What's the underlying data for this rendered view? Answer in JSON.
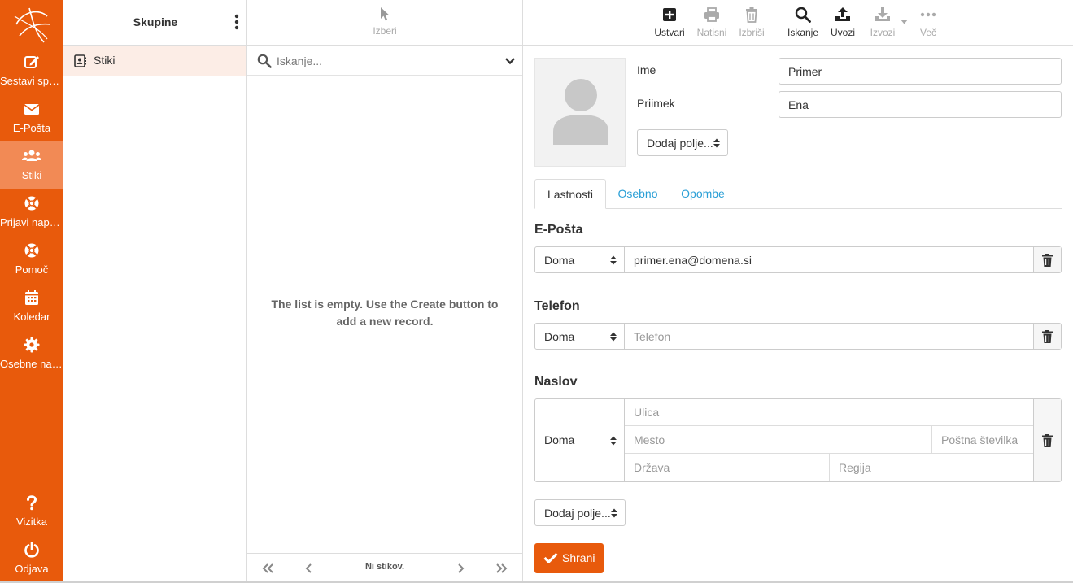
{
  "nav": {
    "items": [
      {
        "label": "Sestavi sporočilo",
        "icon": "compose-icon"
      },
      {
        "label": "E-Pošta",
        "icon": "envelope-icon"
      },
      {
        "label": "Stiki",
        "icon": "users-icon"
      },
      {
        "label": "Prijavi napako",
        "icon": "lifebuoy-icon"
      },
      {
        "label": "Pomoč",
        "icon": "lifebuoy-icon"
      },
      {
        "label": "Koledar",
        "icon": "calendar-icon"
      },
      {
        "label": "Osebne nastavitve",
        "icon": "gear-icon"
      },
      {
        "label": "Vizitka",
        "icon": "question-icon"
      },
      {
        "label": "Odjava",
        "icon": "power-icon"
      }
    ],
    "active_index": 2
  },
  "groups": {
    "title": "Skupine",
    "items": [
      {
        "label": "Stiki",
        "icon": "address-book-icon"
      }
    ]
  },
  "list": {
    "select_label": "Izberi",
    "search_placeholder": "Iskanje...",
    "empty_message": "The list is empty. Use the Create button to add a new record.",
    "pager_text": "Ni stikov."
  },
  "toolbar": {
    "create": "Ustvari",
    "print": "Natisni",
    "delete": "Izbriši",
    "search": "Iskanje",
    "import": "Uvozi",
    "export": "Izvozi",
    "more": "Več"
  },
  "form": {
    "first_name_label": "Ime",
    "first_name_value": "Primer",
    "last_name_label": "Priimek",
    "last_name_value": "Ena",
    "add_field_label": "Dodaj polje...",
    "tabs": [
      "Lastnosti",
      "Osebno",
      "Opombe"
    ],
    "email": {
      "title": "E-Pošta",
      "type": "Doma",
      "value": "primer.ena@domena.si"
    },
    "phone": {
      "title": "Telefon",
      "type": "Doma",
      "placeholder": "Telefon"
    },
    "address": {
      "title": "Naslov",
      "type": "Doma",
      "street_placeholder": "Ulica",
      "city_placeholder": "Mesto",
      "zip_placeholder": "Poštna številka",
      "country_placeholder": "Država",
      "region_placeholder": "Regija"
    },
    "add_field_bottom_label": "Dodaj polje...",
    "save_label": "Shrani"
  },
  "colors": {
    "accent": "#e85a0c",
    "nav_active": "#f28a55",
    "link": "#2a9fd6",
    "group_selected": "#fcede6"
  }
}
